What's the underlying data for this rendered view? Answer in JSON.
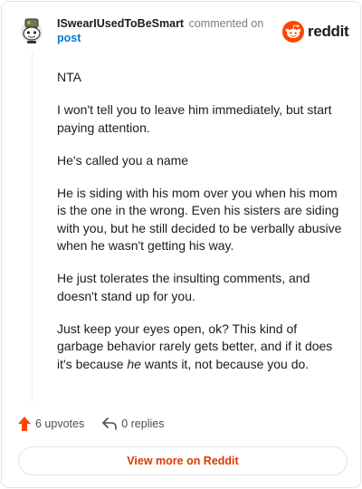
{
  "header": {
    "username": "ISwearIUsedToBeSmart",
    "commented_text": "commented on",
    "post_link": "post",
    "brand": "reddit"
  },
  "comment": {
    "paragraphs": [
      "NTA",
      "I won't tell you to leave him immediately, but start paying attention.",
      "He's called you a name",
      "He is siding with his mom over you when his mom is the one in the wrong. Even his sisters are siding with you, but he still decided to be verbally abusive when he wasn't getting his way.",
      "He just tolerates the insulting comments, and doesn't stand up for you."
    ],
    "last_paragraph": {
      "before": "Just keep your eyes open, ok? This kind of garbage behavior rarely gets better, and if it does it's because ",
      "emphasis": "he",
      "after": " wants it, not because you do."
    }
  },
  "actions": {
    "upvotes_label": "6 upvotes",
    "replies_label": "0 replies"
  },
  "footer": {
    "view_button_label": "View more on Reddit"
  },
  "colors": {
    "upvote": "#ff4500",
    "link": "#0079d3",
    "button_text": "#d93a00",
    "brand_orange": "#ff4500"
  },
  "icons": {
    "avatar": "snoo-avatar-icon",
    "brand": "reddit-logo-icon",
    "upvote": "upvote-arrow-icon",
    "reply": "reply-arrow-icon"
  }
}
